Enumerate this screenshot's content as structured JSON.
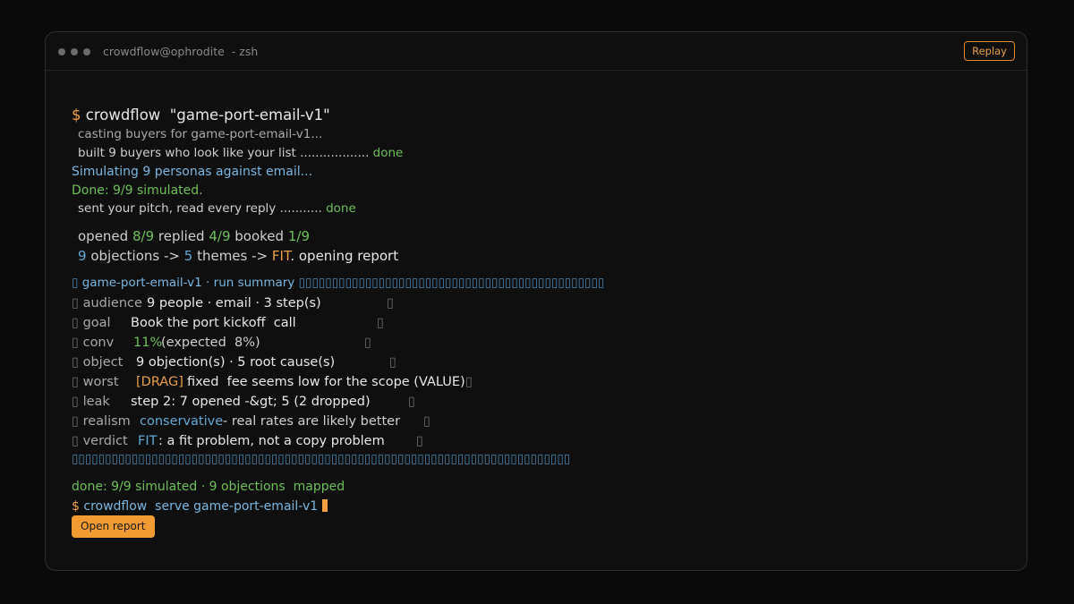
{
  "window": {
    "title": "crowdflow@ophrodite",
    "subtitle": "- zsh",
    "replay_label": "Replay"
  },
  "terminal": {
    "prompt_symbol": "$",
    "command1": "crowdflow  \"game-port-email-v1\"",
    "casting": "casting buyers for game-port-email-v1...",
    "built": "built 9 buyers who look like your list ..................",
    "built_done": "done",
    "simulating": "Simulating 9 personas against email...",
    "done_sim": "Done: 9/9 simulated.",
    "sent": "sent your pitch, read every reply ...........",
    "sent_done": "done",
    "stats": {
      "opened_label": "opened",
      "opened_val": "8/9",
      "replied_label": "replied",
      "replied_val": "4/9",
      "booked_label": "booked",
      "booked_val": "1/9"
    },
    "flow": {
      "objections_num": "9",
      "objections_label": "objections ->",
      "themes_num": "5",
      "themes_label": "themes ->",
      "fit": "FIT",
      "opening": ". opening report"
    }
  },
  "summary": {
    "header_prefix": "▯",
    "header_text": "game-port-email-v1 · run summary",
    "header_fill": "▯▯▯▯▯▯▯▯▯▯▯▯▯▯▯▯▯▯▯▯▯▯▯▯▯▯▯▯▯▯▯▯▯▯▯▯▯▯▯▯▯▯▯▯▯▯",
    "box_char": "▯",
    "rows": [
      {
        "key": "audience",
        "value": "9 people · email · 3 step(s)"
      },
      {
        "key": "goal",
        "value": "Book the port kickoff  call"
      },
      {
        "key": "conv",
        "value_accent": "11%",
        "value": "(expected  8%)"
      },
      {
        "key": "object",
        "value": "9 objection(s) · 5 root cause(s)"
      },
      {
        "key": "worst",
        "value_accent": "[DRAG]",
        "value": "fixed  fee seems low for the scope (VALUE)"
      },
      {
        "key": "leak",
        "value": "step 2: 7 opened -&gt; 5 (2 dropped)"
      },
      {
        "key": "realism",
        "value_accent": "conservative",
        "value": "- real rates are likely better"
      },
      {
        "key": "verdict",
        "value_accent": "FIT",
        "value": ": a fit problem, not a copy problem"
      }
    ],
    "footer_fill": "▯▯▯▯▯▯▯▯▯▯▯▯▯▯▯▯▯▯▯▯▯▯▯▯▯▯▯▯▯▯▯▯▯▯▯▯▯▯▯▯▯▯▯▯▯▯▯▯▯▯▯▯▯▯▯▯▯▯▯▯▯▯▯▯▯▯▯▯▯▯▯▯▯▯▯"
  },
  "final": {
    "done_line": "done: 9/9 simulated · 9 objections  mapped",
    "command2": "crowdflow  serve game-port-email-v1",
    "open_report_label": "Open report"
  },
  "colors": {
    "accent_orange": "#f0a040",
    "green": "#6fbf5a",
    "blue": "#62a8d6",
    "background": "#0f0f0f"
  }
}
